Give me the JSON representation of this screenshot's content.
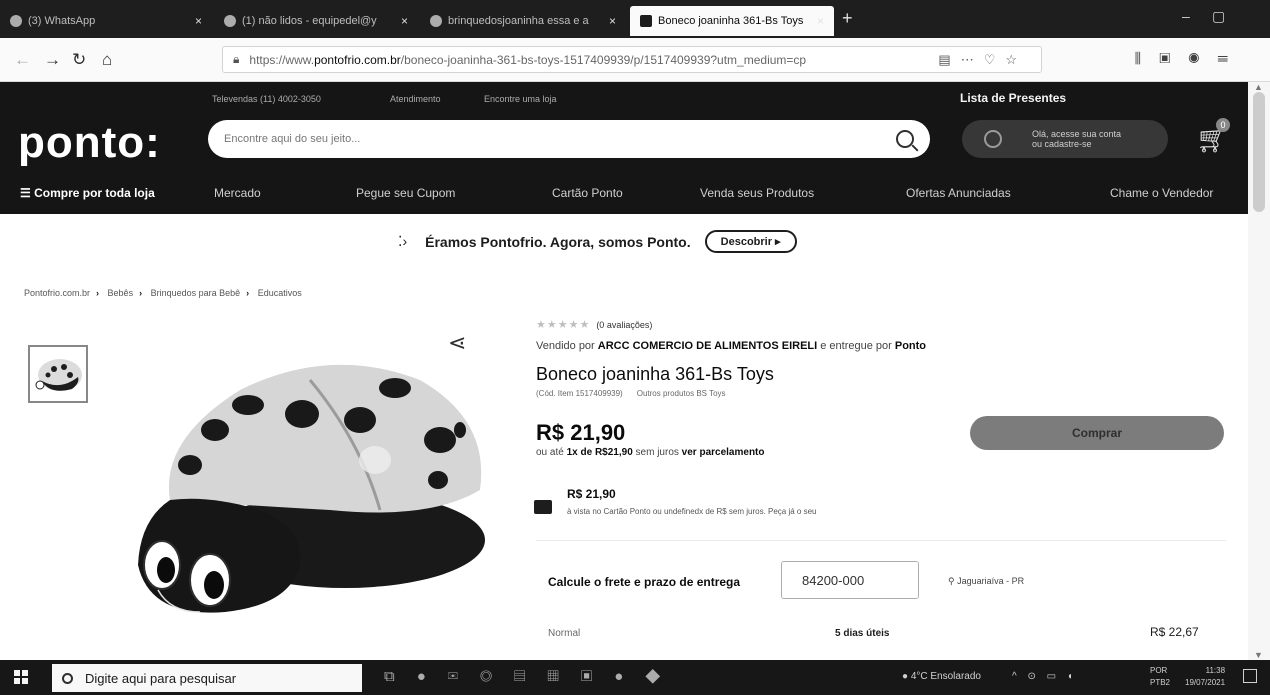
{
  "browser": {
    "tabs": [
      {
        "title": "(3) WhatsApp",
        "active": false
      },
      {
        "title": "(1) não lidos - equipedel@y",
        "active": false
      },
      {
        "title": "brinquedosjoaninha essa e a",
        "active": false
      },
      {
        "title": "Boneco joaninha 361-Bs Toys",
        "active": true
      }
    ],
    "close_glyph": "×",
    "url_prefix": "https://www.",
    "url_domain": "pontofrio.com.br",
    "url_path": "/boneco-joaninha-361-bs-toys-1517409939/p/1517409939?utm_medium=cp"
  },
  "header": {
    "televendas": "Televendas (11) 4002-3050",
    "atendimento": "Atendimento",
    "encontre": "Encontre uma loja",
    "gift_list": "Lista de Presentes",
    "logo": "ponto:",
    "search_placeholder": "Encontre aqui do seu jeito...",
    "account_line1": "Olá, acesse sua conta",
    "account_line2": "ou cadastre-se",
    "cart_count": "0"
  },
  "menu": [
    "☰ Compre por toda loja",
    "Mercado",
    "Pegue seu Cupom",
    "Cartão Ponto",
    "Venda seus Produtos",
    "Ofertas Anunciadas",
    "Chame o Vendedor"
  ],
  "promo": {
    "text": "Éramos Pontofrio. Agora, somos Ponto.",
    "button": "Descobrir ▸"
  },
  "breadcrumb": [
    "Pontofrio.com.br",
    "Bebês",
    "Brinquedos para Bebê",
    "Educativos"
  ],
  "product": {
    "stars": "★★★★★",
    "reviews": "(0 avaliações)",
    "sold_by_prefix": "Vendido por ",
    "seller": "ARCC COMERCIO DE ALIMENTOS EIRELI",
    "delivered_by_text": " e entregue por ",
    "delivered_by": "Ponto",
    "title": "Boneco joaninha 361-Bs Toys",
    "code": "(Cód. Item 1517409939)",
    "other_products": "Outros produtos BS Toys",
    "price": "R$ 21,90",
    "installments_prefix": "ou até ",
    "installments_bold": "1x de R$21,90",
    "installments_suffix": " sem juros ",
    "installments_link": "ver parcelamento",
    "buy_button": "Comprar",
    "card_price": "R$ 21,90",
    "card_note": "à vista no Cartão Ponto ou undefinedx de R$ sem juros. Peça já o seu"
  },
  "shipping": {
    "label": "Calcule o frete e prazo de entrega",
    "cep": "84200-000",
    "city": "Jaguariaíva - PR",
    "type": "Normal",
    "days": "5 dias úteis",
    "price": "R$ 22,67"
  },
  "taskbar": {
    "search": "Digite aqui para pesquisar",
    "weather": "4°C  Ensolarado",
    "lang1": "POR",
    "lang2": "PTB2",
    "time": "11:38",
    "date": "19/07/2021"
  }
}
